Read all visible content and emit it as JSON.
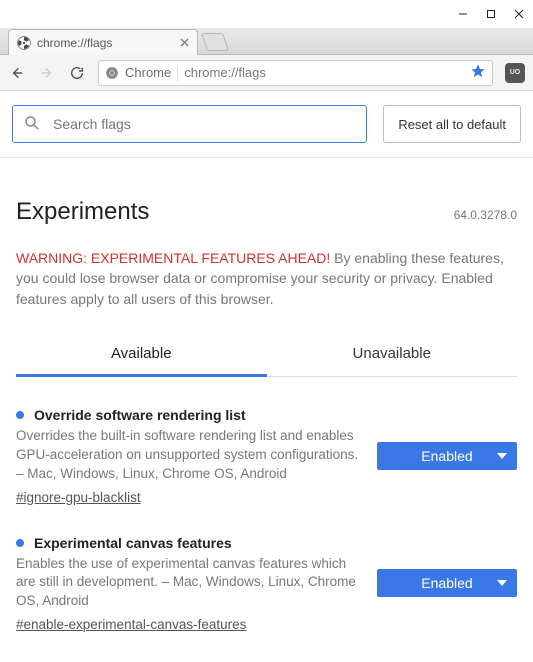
{
  "window": {
    "tab_title": "chrome://flags"
  },
  "omnibox": {
    "security_label": "Chrome",
    "url": "chrome://flags"
  },
  "extension": {
    "badge": "UO"
  },
  "search": {
    "placeholder": "Search flags"
  },
  "buttons": {
    "reset": "Reset all to default"
  },
  "page": {
    "title": "Experiments",
    "version": "64.0.3278.0",
    "warning_label": "WARNING: EXPERIMENTAL FEATURES AHEAD!",
    "warning_body": "By enabling these features, you could lose browser data or compromise your security or privacy. Enabled features apply to all users of this browser."
  },
  "tabs": {
    "available": "Available",
    "unavailable": "Unavailable"
  },
  "experiments": [
    {
      "title": "Override software rendering list",
      "desc": "Overrides the built-in software rendering list and enables GPU-acceleration on unsupported system configurations. – Mac, Windows, Linux, Chrome OS, Android",
      "hash": "#ignore-gpu-blacklist",
      "value": "Enabled"
    },
    {
      "title": "Experimental canvas features",
      "desc": "Enables the use of experimental canvas features which are still in development. – Mac, Windows, Linux, Chrome OS, Android",
      "hash": "#enable-experimental-canvas-features",
      "value": "Enabled"
    }
  ]
}
